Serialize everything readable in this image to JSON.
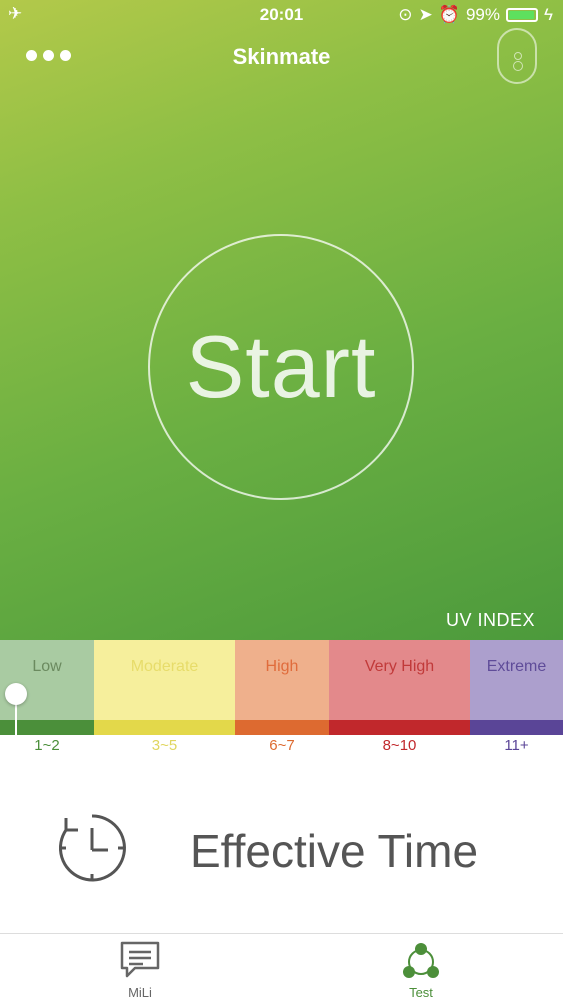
{
  "statusbar": {
    "time": "20:01",
    "battery": "99%",
    "airplane_icon": "airplane-icon"
  },
  "nav": {
    "title": "Skinmate"
  },
  "start": {
    "label": "Start"
  },
  "uv": {
    "header": "UV INDEX",
    "levels": [
      {
        "label": "Low",
        "range": "1~2",
        "bg": "#a9cba2",
        "text": "#6b8a5f",
        "bar": "#4b8f3a"
      },
      {
        "label": "Moderate",
        "range": "3~5",
        "bg": "#f6ef9c",
        "text": "#e7dc6a",
        "bar": "#e3d84a"
      },
      {
        "label": "High",
        "range": "6~7",
        "bg": "#efb08c",
        "text": "#e06c3c",
        "bar": "#dd6a30"
      },
      {
        "label": "Very High",
        "range": "8~10",
        "bg": "#e3898b",
        "text": "#c13a3a",
        "bar": "#c1282c"
      },
      {
        "label": "Extreme",
        "range": "11+",
        "bg": "#ac9fcd",
        "text": "#5f4c99",
        "bar": "#5a4597"
      }
    ],
    "selected_level": 0
  },
  "effective": {
    "label": "Effective Time"
  },
  "tabs": [
    {
      "label": "MiLi",
      "icon": "chat-icon",
      "active": false
    },
    {
      "label": "Test",
      "icon": "molecule-icon",
      "active": true
    }
  ]
}
